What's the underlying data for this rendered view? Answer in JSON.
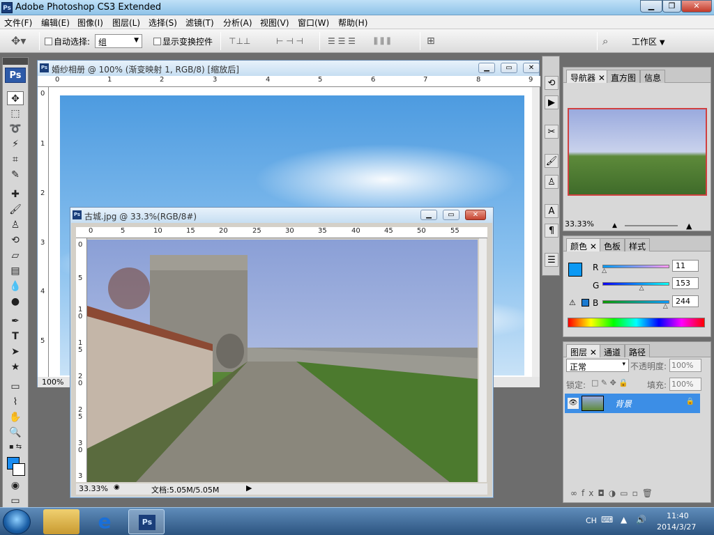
{
  "app": {
    "title": "Adobe Photoshop CS3 Extended",
    "logo_text": "Ps"
  },
  "menu": [
    {
      "label": "文件(F)"
    },
    {
      "label": "编辑(E)"
    },
    {
      "label": "图像(I)"
    },
    {
      "label": "图层(L)"
    },
    {
      "label": "选择(S)"
    },
    {
      "label": "滤镜(T)"
    },
    {
      "label": "分析(A)"
    },
    {
      "label": "视图(V)"
    },
    {
      "label": "窗口(W)"
    },
    {
      "label": "帮助(H)"
    }
  ],
  "options": {
    "auto_select_label": "自动选择:",
    "auto_select_value": "组",
    "show_transform_label": "显示变换控件",
    "workspace_label": "工作区"
  },
  "doc1": {
    "title": "婚纱相册 @ 100% (渐变映射 1, RGB/8) [缩放后]",
    "zoom": "100%",
    "ruler_top": [
      "0",
      "1",
      "2",
      "3",
      "4",
      "5",
      "6",
      "7",
      "8",
      "9"
    ],
    "ruler_left": [
      "0",
      "1",
      "2",
      "3",
      "4",
      "5"
    ]
  },
  "doc2": {
    "title": "古城.jpg @ 33.3%(RGB/8#)",
    "zoom": "33.33%",
    "doc_info": "文档:5.05M/5.05M",
    "ruler_top": [
      "0",
      "5",
      "10",
      "15",
      "20",
      "25",
      "30",
      "35",
      "40",
      "45",
      "50",
      "55"
    ],
    "ruler_left": [
      "0",
      "5",
      "1\n0",
      "1\n5",
      "2\n0",
      "2\n5",
      "3\n0",
      "3"
    ]
  },
  "navigator": {
    "tabs": [
      "导航器",
      "直方图",
      "信息"
    ],
    "zoom": "33.33%"
  },
  "color": {
    "tabs": [
      "颜色",
      "色板",
      "样式"
    ],
    "r_label": "R",
    "g_label": "G",
    "b_label": "B",
    "r": 11,
    "g": 153,
    "b": 244,
    "r_value": "11",
    "g_value": "153",
    "b_value": "244",
    "fg_color": "#0b99f4"
  },
  "layers": {
    "tabs": [
      "图层",
      "通道",
      "路径"
    ],
    "blend_mode": "正常",
    "opacity_label": "不透明度:",
    "opacity": "100%",
    "lock_label": "锁定:",
    "fill_label": "填充:",
    "fill": "100%",
    "layer_name": "背景"
  },
  "taskbar": {
    "lang": "CH",
    "time": "11:40",
    "date": "2014/3/27",
    "ps_label": "Ps"
  }
}
